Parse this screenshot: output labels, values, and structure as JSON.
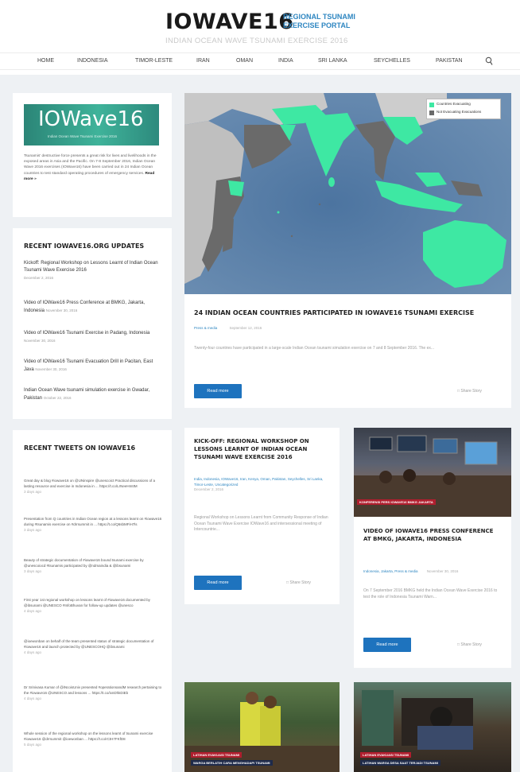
{
  "header": {
    "title": "IOWAVE16",
    "subtitle_line1": "REGIONAL TSUNAMI",
    "subtitle_line2": "EXERCISE PORTAL",
    "tagline": "INDIAN OCEAN WAVE TSUNAMI EXERCISE 2016"
  },
  "nav": {
    "items": [
      "HOME",
      "INDONESIA",
      "TIMOR-LESTE",
      "IRAN",
      "OMAN",
      "INDIA",
      "SRI LANKA",
      "SEYCHELLES",
      "PAKISTAN"
    ],
    "search_icon": "search-icon"
  },
  "logo_card": {
    "logo_text": "IOWave16",
    "logo_small": "Indian Ocean Wave Tsunami Exercise 2016",
    "caption": "Tsunamis' destructive force presents a great risk for lives and livelihoods in the exposed areas in Asia and the Pacific. On 7-8 September 2016, Indian Ocean Wave 2016 exercises (IOWave16) have been carried out in 24 Indian Ocean countries to test standard operating procedures of emergency services.",
    "read_more": "Read more »"
  },
  "updates": {
    "heading": "RECENT IOWAVE16.ORG UPDATES",
    "items": [
      {
        "title": "Kickoff: Regional Workshop on Lessons Learnt of Indian Ocean Tsunami Wave Exercise 2016",
        "date": "December 2, 2016"
      },
      {
        "title": "Video of IOWave16 Press Conference at BMKG, Jakarta, Indonesia",
        "date": "November 30, 2016"
      },
      {
        "title": "Video of IOWave16 Tsunami Exercise in Padang, Indonesia",
        "date": "November 30, 2016"
      },
      {
        "title": "Video of IOWave16 Tsunami Evacuation Drill in Pacitan, East Java",
        "date": "November 30, 2016"
      },
      {
        "title": "Indian Ocean Wave tsunami simulation exercise in Gwadar, Pakistan",
        "date": "October 22, 2016"
      }
    ]
  },
  "tweets": {
    "heading": "RECENT TWEETS ON IOWAVE16",
    "items": [
      {
        "text": "Great day & blog #iowave16 on @UNinspire @unescoict Practical discussions of a lasting resource and exercise in Indonesia in ... https://t.co/LrNeeHmtIM",
        "time": "3 days ago"
      },
      {
        "text": "Presentation from Q countries in Indian Ocean region at a lessons learnt on #iowave16 during #tsunamis exercise on #drrsummit in ... https://t.co/Q6sbMFiH7ls",
        "time": "3 days ago"
      },
      {
        "text": "Beauty of strategic documentation of #iowave16 bound tsunami exercise by @unescoiocd #tsunamis participated by @ndmaindia & @ibsunami",
        "time": "3 days ago"
      },
      {
        "text": "First year 1st regional workshop on lessons learnt of #iowave16 documented by @ibsunami @UNESCO #InfoBhuvan for follow-up updates @unesco",
        "time": "4 days ago"
      },
      {
        "text": "@ioewonban on behalf of the team presented status of strategic documentation of #iowave16 and launch protected by @UNESCOHQ @ibsunami",
        "time": "4 days ago"
      },
      {
        "text": "Dr Srinivasa Kumar of @iNcoisUniv presented #operationsandM research pertaining to the #iowave16 @UNESCO and lessons ... https://t.co/ixnDhkDiEb",
        "time": "4 days ago"
      },
      {
        "text": "Whole session of the regional workshop on the lessons learnt of tsunami exercise #iowave16 @drrsummit @ioewonban ... https://t.co/rCtH7FKfD8",
        "time": "5 days ago"
      }
    ]
  },
  "map": {
    "legend_label_1": "Countries Evacuating",
    "legend_label_2": "Not Evacuating Evacuations",
    "color_participating": "#3ee8a3",
    "color_not": "#6a6a6a"
  },
  "main_post": {
    "title": "24 INDIAN OCEAN COUNTRIES PARTICIPATED IN IOWAVE16 TSUNAMI EXERCISE",
    "category": "Press & media",
    "date": "September 12, 2016",
    "excerpt": "Twenty-four countries have participated in a large-scale Indian Ocean tsunami simulation exercise on 7 and 8 September 2016. The ex...",
    "button": "Read more",
    "share": "Share Story"
  },
  "kickoff_post": {
    "title": "KICK-OFF: REGIONAL WORKSHOP ON LESSONS LEARNT OF INDIAN OCEAN TSUNAMI WAVE EXERCISE 2016",
    "tags": "India, Indonesia, IOWave16, Iran, Kenya, Oman, Pakistan, Seychelles, Sri Lanka, Timor-Leste, Uncategorized",
    "date": "December 2, 2016",
    "excerpt": "Regional Workshop on Lessons Learnt from Community Response of Indian Ocean Tsunami Wave Exercise IOWave16 and intersessional meeting of Intercountrie...",
    "button": "Read more",
    "share": "Share Story"
  },
  "video_post": {
    "caption": "KONFERENSI PERS IOWAVE16 BMKG JAKARTA",
    "title": "VIDEO OF IOWAVE16 PRESS CONFERENCE AT BMKG, JAKARTA, INDONESIA",
    "tags": "Indonesia, Jakarta, Press & media",
    "date": "November 30, 2016",
    "excerpt": "On 7 September 2016 BMKG held the Indian Ocean Wave Exercise 2016 to test the role of Indonesia Tsunami Warn...",
    "button": "Read more",
    "share": "Share Story"
  },
  "bottom_photos": {
    "left_caption1": "LATIHAN EVAKUASI TSUNAMI",
    "left_caption2": "WARGA BERLATIH CARA MENGHADAPI TSUNAMI",
    "right_caption1": "LATIHAN EVAKUASI TSUNAMI",
    "right_caption2": "LATIHAN WARGA DESA SAAT TERJADI TSUNAMI"
  }
}
